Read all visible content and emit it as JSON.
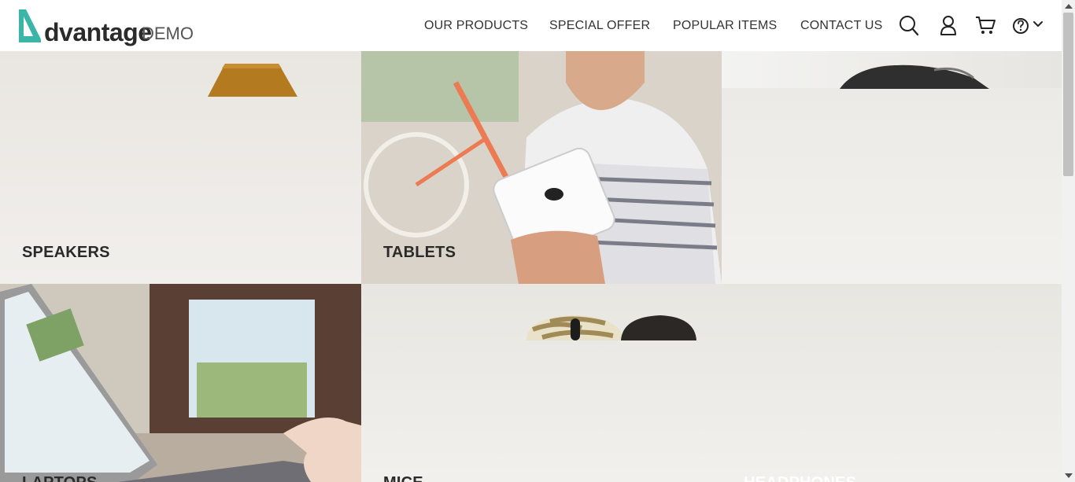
{
  "brand": {
    "name_main": "dvantage",
    "name_suffix": "DEMO",
    "accent_color": "#3ab5a7"
  },
  "nav": {
    "items": [
      {
        "label": "OUR PRODUCTS"
      },
      {
        "label": "SPECIAL OFFER"
      },
      {
        "label": "POPULAR ITEMS"
      },
      {
        "label": "CONTACT US"
      }
    ],
    "icons": [
      "search-icon",
      "user-icon",
      "cart-icon",
      "help-icon",
      "chevron-down-icon"
    ]
  },
  "categories": [
    {
      "label": "SPEAKERS"
    },
    {
      "label": "TABLETS"
    },
    {
      "label": "HEADPHONES"
    },
    {
      "label": "LAPTOPS"
    },
    {
      "label": "MICE"
    }
  ]
}
